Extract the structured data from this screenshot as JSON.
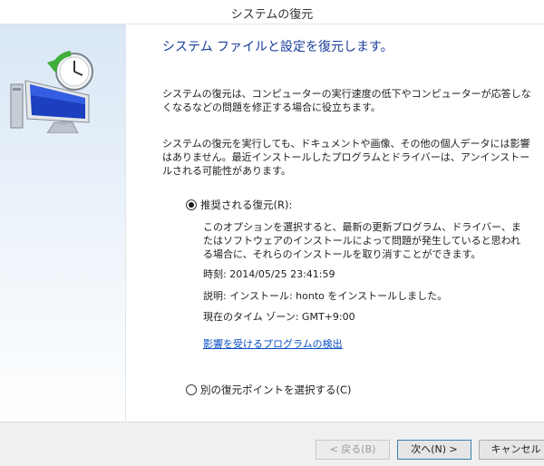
{
  "window": {
    "title": "システムの復元"
  },
  "main": {
    "heading": "システム ファイルと設定を復元します。",
    "paragraph1": "システムの復元は、コンピューターの実行速度の低下やコンピューターが応答しなくなるなどの問題を修正する場合に役立ちます。",
    "paragraph2": "システムの復元を実行しても、ドキュメントや画像、その他の個人データには影響はありません。最近インストールしたプログラムとドライバーは、アンインストールされる可能性があります。",
    "option_recommended": {
      "label": "推奨される復元(R):",
      "selected": true,
      "description": "このオプションを選択すると、最新の更新プログラム、ドライバー、またはソフトウェアのインストールによって問題が発生していると思われる場合に、それらのインストールを取り消すことができます。",
      "time": "時刻: 2014/05/25 23:41:59",
      "note": "説明: インストール: honto をインストールしました。",
      "timezone": "現在のタイム ゾーン: GMT+9:00",
      "link": "影響を受けるプログラムの検出"
    },
    "option_other": {
      "label": "別の復元ポイントを選択する(C)",
      "selected": false
    }
  },
  "footer": {
    "back_label": "< 戻る(B)",
    "next_label": "次へ(N) >",
    "cancel_label": "キャンセル"
  },
  "icons": {
    "sidebar": "system-restore-icon"
  },
  "colors": {
    "heading": "#1a3d9a",
    "link": "#0a4fc2",
    "sidebar_top": "#d9e7f5",
    "footer_bg": "#f0f0f0"
  }
}
